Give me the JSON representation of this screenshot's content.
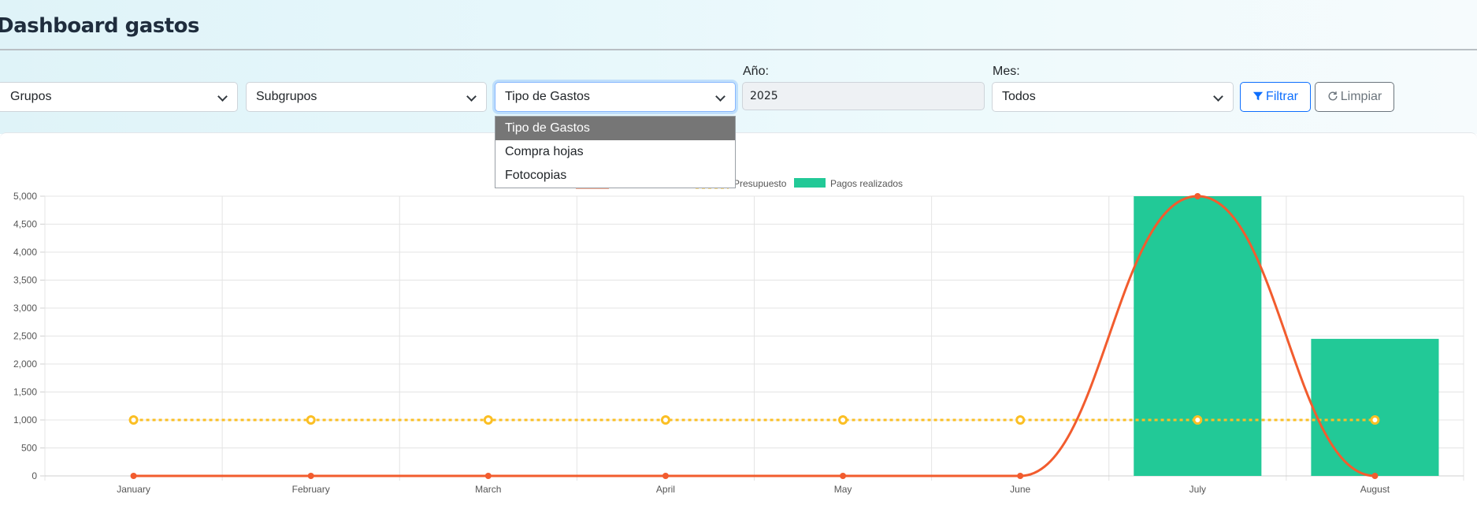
{
  "header": {
    "title": "Dashboard gastos"
  },
  "filters": {
    "groups": "Grupos",
    "subgroups": "Subgrupos",
    "expense_type": "Tipo de Gastos",
    "year_label": "Año:",
    "year_value": "2025",
    "month_label": "Mes:",
    "month_value": "Todos",
    "filter_button": "Filtrar",
    "clear_button": "Limpiar"
  },
  "dropdown": {
    "options": [
      "Tipo de Gastos",
      "Compra hojas",
      "Fotocopias"
    ],
    "selected": "Tipo de Gastos"
  },
  "colors": {
    "accent": "#0d6efd",
    "line": "#f25c2e",
    "budget": "#fbbf24",
    "bars": "#22c997"
  },
  "chart_data": {
    "type": "bar",
    "categories": [
      "January",
      "February",
      "March",
      "April",
      "May",
      "June",
      "July",
      "August"
    ],
    "ylim": [
      0,
      5000
    ],
    "yticks": [
      "0",
      "500",
      "1,000",
      "1,500",
      "2,000",
      "2,500",
      "3,000",
      "3,500",
      "4,000",
      "4,500",
      "5,000"
    ],
    "legend_position": "top-center",
    "grid": true,
    "series": [
      {
        "name": "",
        "kind": "line",
        "values": [
          0,
          0,
          0,
          0,
          0,
          0,
          5000,
          0
        ]
      },
      {
        "name": "Presupuesto",
        "kind": "dashed-line",
        "values": [
          1000,
          1000,
          1000,
          1000,
          1000,
          1000,
          1000,
          1000
        ]
      },
      {
        "name": "Pagos realizados",
        "kind": "bar",
        "values": [
          0,
          0,
          0,
          0,
          0,
          0,
          5000,
          2450
        ]
      }
    ]
  }
}
